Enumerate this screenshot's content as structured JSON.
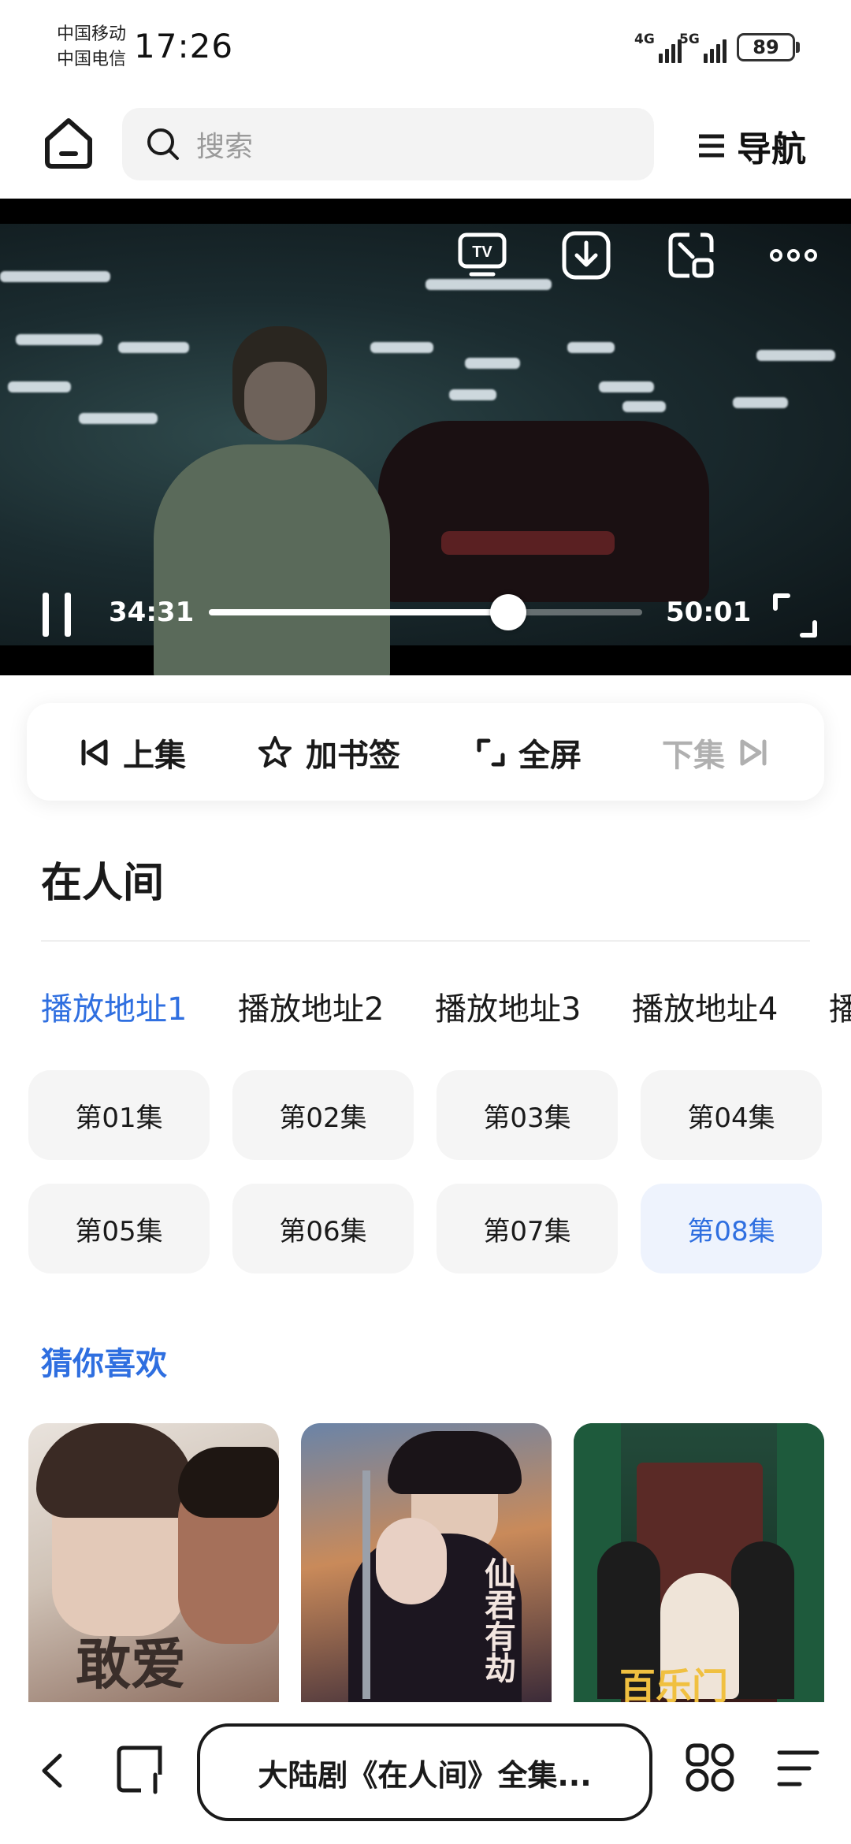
{
  "status": {
    "carrier1": "中国移动",
    "carrier2": "中国电信",
    "time": "17:26",
    "net1": "4G",
    "net2": "5G",
    "battery": "89"
  },
  "topnav": {
    "search_placeholder": "搜索",
    "nav_label": "导航"
  },
  "player": {
    "current_time": "34:31",
    "total_time": "50:01",
    "progress": 0.69,
    "icons": [
      "tv-icon",
      "download-icon",
      "pip-icon",
      "more-icon",
      "pause-icon",
      "fullscreen-icon"
    ]
  },
  "actions": {
    "prev": "上集",
    "bookmark": "加书签",
    "fullscreen": "全屏",
    "next": "下集"
  },
  "show": {
    "title": "在人间"
  },
  "sources": [
    {
      "label": "播放地址1",
      "active": true
    },
    {
      "label": "播放地址2",
      "active": false
    },
    {
      "label": "播放地址3",
      "active": false
    },
    {
      "label": "播放地址4",
      "active": false
    },
    {
      "label": "播",
      "active": false
    }
  ],
  "episodes": [
    {
      "label": "第01集",
      "active": false
    },
    {
      "label": "第02集",
      "active": false
    },
    {
      "label": "第03集",
      "active": false
    },
    {
      "label": "第04集",
      "active": false
    },
    {
      "label": "第05集",
      "active": false
    },
    {
      "label": "第06集",
      "active": false
    },
    {
      "label": "第07集",
      "active": false
    },
    {
      "label": "第08集",
      "active": true
    }
  ],
  "recommend": {
    "heading": "猜你喜欢",
    "posters": [
      {
        "title": "敢爱"
      },
      {
        "title": "仙君有劫"
      },
      {
        "title": "百乐门"
      }
    ]
  },
  "bottombar": {
    "url_title": "大陆剧《在人间》全集..."
  },
  "colors": {
    "accent": "#2f6fe0",
    "chip_bg": "#f5f5f5",
    "chip_active_bg": "#eef3fd"
  }
}
